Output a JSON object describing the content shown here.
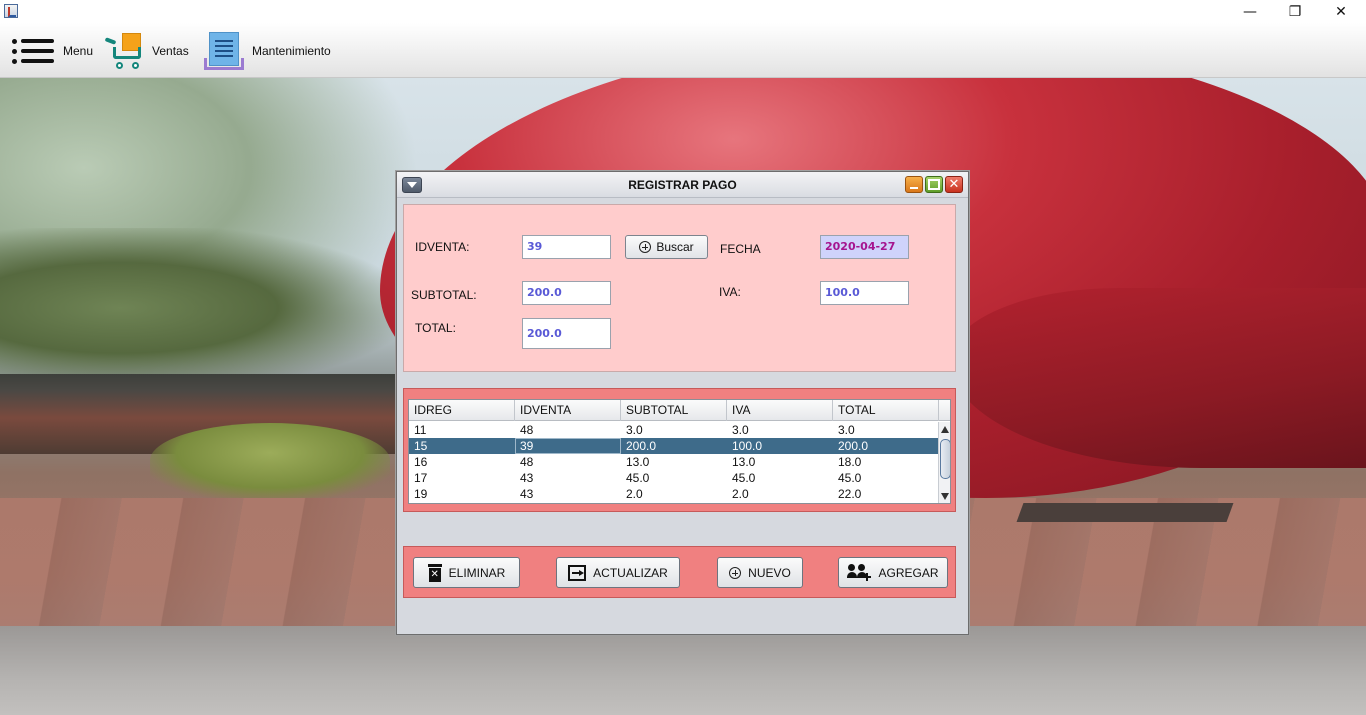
{
  "window": {
    "minimize_glyph": "—",
    "maximize_glyph": "❐",
    "close_glyph": "✕"
  },
  "menubar": {
    "items": [
      {
        "label": "Menu",
        "icon": "hamburger-icon"
      },
      {
        "label": "Ventas",
        "icon": "shopping-cart-icon"
      },
      {
        "label": "Mantenimiento",
        "icon": "receipt-icon"
      }
    ]
  },
  "dialog": {
    "title": "REGISTRAR PAGO",
    "close_glyph": "✕",
    "form": {
      "idventa_label": "IDVENTA:",
      "idventa_value": "39",
      "buscar_label": "Buscar",
      "fecha_label": "FECHA",
      "fecha_value": "2020-04-27",
      "subtotal_label": "SUBTOTAL:",
      "subtotal_value": "200.0",
      "iva_label": "IVA:",
      "iva_value": "100.0",
      "total_label": "TOTAL:",
      "total_value": "200.0"
    },
    "table": {
      "columns": [
        "IDREG",
        "IDVENTA",
        "SUBTOTAL",
        "IVA",
        "TOTAL"
      ],
      "rows": [
        [
          "11",
          "48",
          "3.0",
          "3.0",
          "3.0"
        ],
        [
          "15",
          "39",
          "200.0",
          "100.0",
          "200.0"
        ],
        [
          "16",
          "48",
          "13.0",
          "13.0",
          "18.0"
        ],
        [
          "17",
          "43",
          "45.0",
          "45.0",
          "45.0"
        ],
        [
          "19",
          "43",
          "2.0",
          "2.0",
          "22.0"
        ]
      ],
      "selected_row": 1
    },
    "actions": {
      "eliminar": "ELIMINAR",
      "actualizar": "ACTUALIZAR",
      "nuevo": "NUEVO",
      "agregar": "AGREGAR"
    }
  },
  "colors": {
    "form_bg": "#ffcccc",
    "panel_bg": "#f08080",
    "selected_row": "#3e6b8a",
    "field_text": "#5959d6",
    "date_text": "#a5148f"
  }
}
